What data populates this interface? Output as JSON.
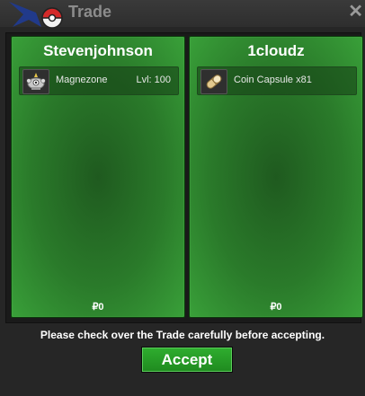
{
  "window": {
    "title": "Trade",
    "close_label": "✕"
  },
  "left": {
    "name": "Stevenjohnson",
    "item": {
      "icon": "magnezone-icon",
      "name": "Magnezone",
      "level": "Lvl: 100"
    },
    "money": "₽0"
  },
  "right": {
    "name": "1cloudz",
    "item": {
      "icon": "coin-capsule-icon",
      "name": "Coin Capsule x81",
      "level": ""
    },
    "money": "₽0"
  },
  "notice": "Please check over the Trade carefully before accepting.",
  "accept_label": "Accept",
  "colors": {
    "panel_green": "#2a7a2a",
    "accent": "#1f8a1f",
    "title_text": "#8c8c8c"
  }
}
